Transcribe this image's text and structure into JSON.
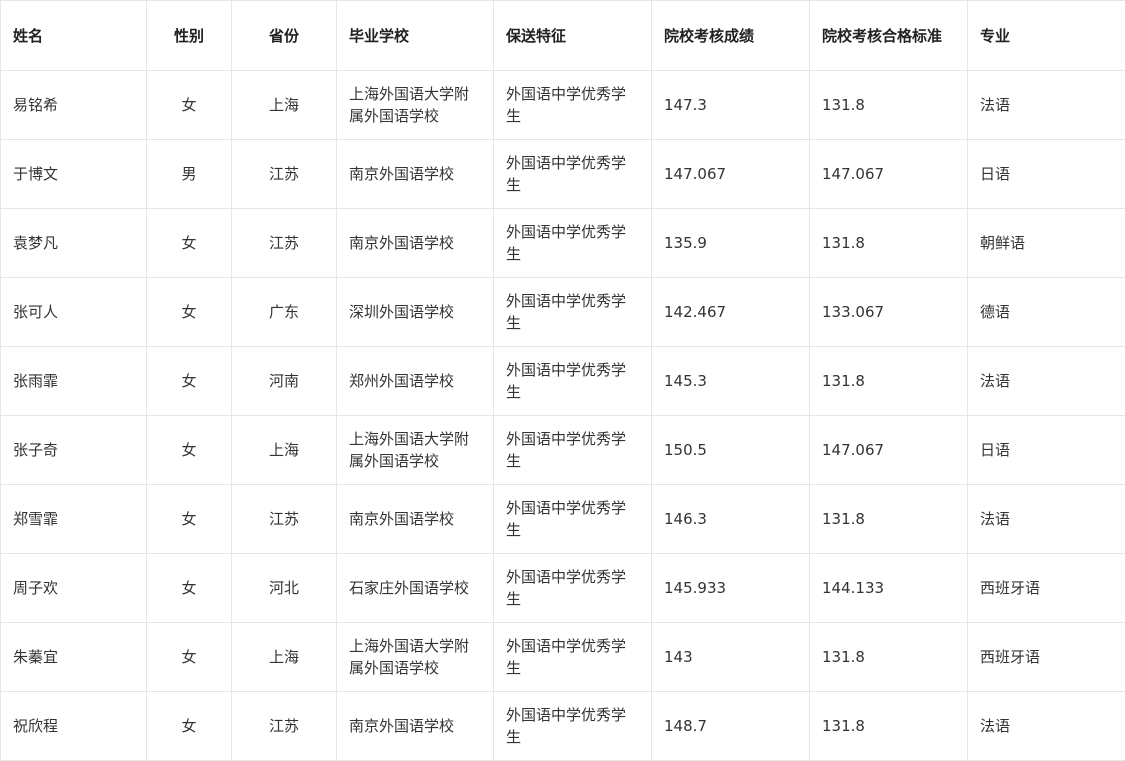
{
  "table": {
    "headers": [
      "姓名",
      "性别",
      "省份",
      "毕业学校",
      "保送特征",
      "院校考核成绩",
      "院校考核合格标准",
      "专业"
    ],
    "rows": [
      [
        "易铭希",
        "女",
        "上海",
        "上海外国语大学附属外国语学校",
        "外国语中学优秀学生",
        "147.3",
        "131.8",
        "法语"
      ],
      [
        "于博文",
        "男",
        "江苏",
        "南京外国语学校",
        "外国语中学优秀学生",
        "147.067",
        "147.067",
        "日语"
      ],
      [
        "袁梦凡",
        "女",
        "江苏",
        "南京外国语学校",
        "外国语中学优秀学生",
        "135.9",
        "131.8",
        "朝鲜语"
      ],
      [
        "张可人",
        "女",
        "广东",
        "深圳外国语学校",
        "外国语中学优秀学生",
        "142.467",
        "133.067",
        "德语"
      ],
      [
        "张雨霏",
        "女",
        "河南",
        "郑州外国语学校",
        "外国语中学优秀学生",
        "145.3",
        "131.8",
        "法语"
      ],
      [
        "张子奇",
        "女",
        "上海",
        "上海外国语大学附属外国语学校",
        "外国语中学优秀学生",
        "150.5",
        "147.067",
        "日语"
      ],
      [
        "郑雪霏",
        "女",
        "江苏",
        "南京外国语学校",
        "外国语中学优秀学生",
        "146.3",
        "131.8",
        "法语"
      ],
      [
        "周子欢",
        "女",
        "河北",
        "石家庄外国语学校",
        "外国语中学优秀学生",
        "145.933",
        "144.133",
        "西班牙语"
      ],
      [
        "朱蓁宜",
        "女",
        "上海",
        "上海外国语大学附属外国语学校",
        "外国语中学优秀学生",
        "143",
        "131.8",
        "西班牙语"
      ],
      [
        "祝欣程",
        "女",
        "江苏",
        "南京外国语学校",
        "外国语中学优秀学生",
        "148.7",
        "131.8",
        "法语"
      ]
    ]
  },
  "colors": {
    "border": "#e6e6e6",
    "text": "#333333",
    "header_text": "#222222"
  }
}
